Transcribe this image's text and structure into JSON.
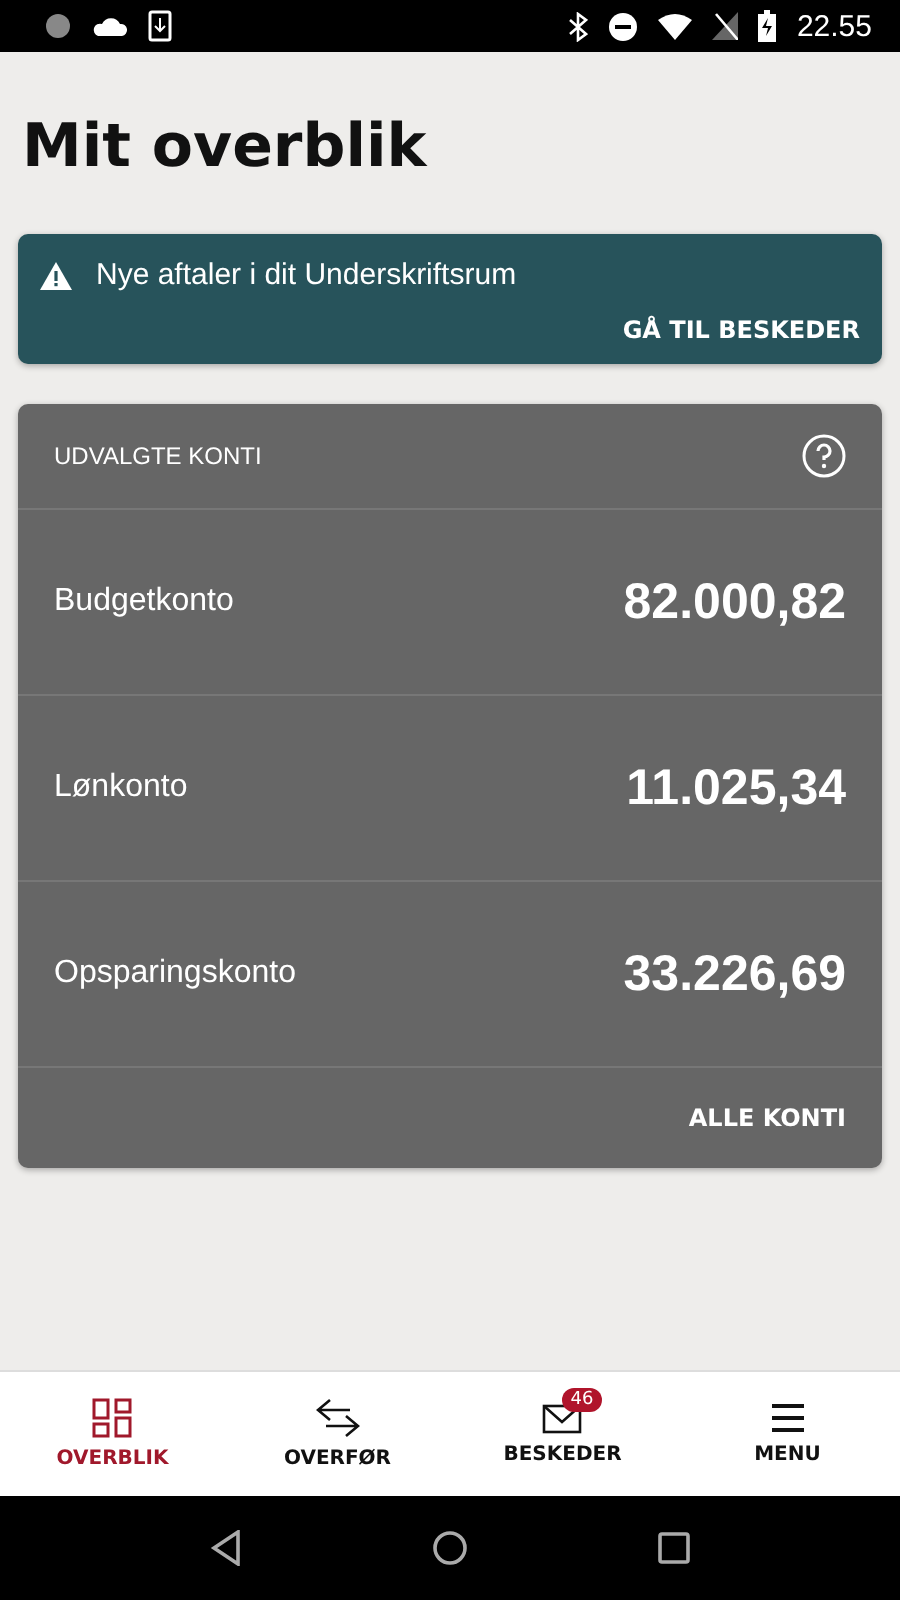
{
  "status_bar": {
    "time": "22.55"
  },
  "title": "Mit overblik",
  "notice": {
    "text": "Nye aftaler i dit Underskriftsrum",
    "action": "GÅ TIL BESKEDER"
  },
  "accounts": {
    "heading": "UDVALGTE KONTI",
    "rows": [
      {
        "name": "Budgetkonto",
        "balance": "82.000,82"
      },
      {
        "name": "Lønkonto",
        "balance": "11.025,34"
      },
      {
        "name": "Opsparingskonto",
        "balance": "33.226,69"
      }
    ],
    "footer_link": "ALLE KONTI"
  },
  "tabs": [
    {
      "kind": "overview",
      "label": "OVERBLIK",
      "selected": true
    },
    {
      "kind": "transfer",
      "label": "OVERFØR",
      "selected": false
    },
    {
      "kind": "messages",
      "label": "BESKEDER",
      "selected": false,
      "badge": "46"
    },
    {
      "kind": "menu",
      "label": "MENU",
      "selected": false
    }
  ]
}
